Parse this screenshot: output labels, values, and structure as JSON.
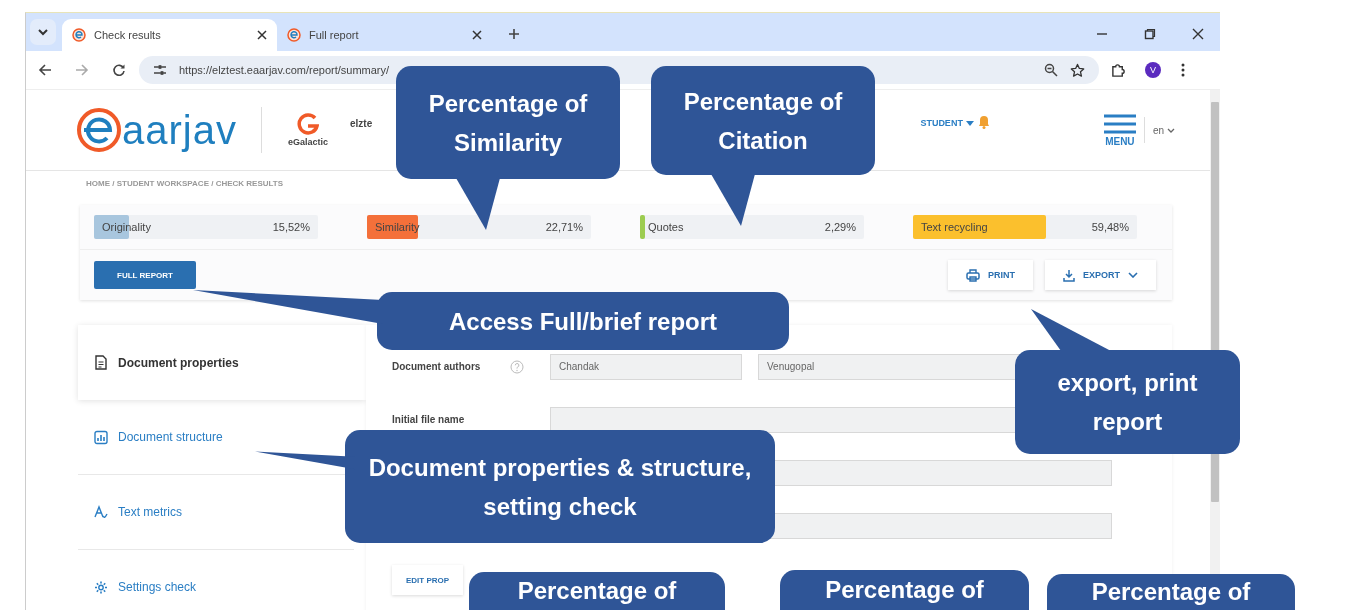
{
  "browser": {
    "tabs": [
      {
        "title": "Check results",
        "selected": true
      },
      {
        "title": "Full report",
        "selected": false
      }
    ],
    "url": "https://elztest.eaarjav.com/report/summary/",
    "profile_initial": "V"
  },
  "header": {
    "logo_text": "aarjav",
    "partner": "eGalactic",
    "org": "elzte",
    "role": "STUDENT",
    "menu": "MENU",
    "language": "en"
  },
  "breadcrumb": "HOME / STUDENT WORKSPACE / CHECK RESULTS",
  "metrics": [
    {
      "label": "Originality",
      "value": "15,52%",
      "level": 0.1552,
      "color": "#a8c6de"
    },
    {
      "label": "Similarity",
      "value": "22,71%",
      "level": 0.2271,
      "color": "#f4703a"
    },
    {
      "label": "Quotes",
      "value": "2,29%",
      "level": 0.0229,
      "color": "#9ccc50"
    },
    {
      "label": "Text recycling",
      "value": "59,48%",
      "level": 0.5948,
      "color": "#fbc02d"
    }
  ],
  "actions": {
    "full_report": "FULL REPORT",
    "print": "PRINT",
    "export": "EXPORT"
  },
  "sidebar": [
    {
      "label": "Document properties",
      "selected": true
    },
    {
      "label": "Document structure",
      "selected": false
    },
    {
      "label": "Text metrics",
      "selected": false
    },
    {
      "label": "Settings check",
      "selected": false
    }
  ],
  "properties": {
    "authors_label": "Document authors",
    "authors": [
      "Chandak",
      "Venugopal"
    ],
    "file_label": "Initial file name",
    "edit_button": "EDIT PROP"
  },
  "callouts": [
    "Percentage of Similarity",
    "Percentage of Citation",
    "Access Full/brief report",
    "export, print report",
    "Document properties & structure, setting check",
    "Percentage of",
    "Percentage of",
    "Percentage of"
  ]
}
